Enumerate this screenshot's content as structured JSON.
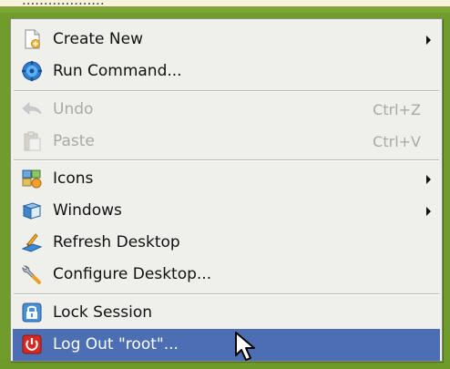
{
  "background": {
    "top_text": "..................."
  },
  "menu": {
    "items": [
      {
        "label": "Create New",
        "icon": "new-document-icon",
        "submenu": true
      },
      {
        "label": "Run Command...",
        "icon": "run-command-gear-icon"
      },
      {
        "label": "Undo",
        "accel": "U",
        "icon": "undo-arrow-icon",
        "shortcut": "Ctrl+Z",
        "disabled": true
      },
      {
        "label": "Paste",
        "accel": "P",
        "icon": "paste-clipboard-icon",
        "shortcut": "Ctrl+V",
        "disabled": true
      },
      {
        "label": "Icons",
        "icon": "icons-icon",
        "submenu": true
      },
      {
        "label": "Windows",
        "icon": "windows-icon",
        "submenu": true
      },
      {
        "label": "Refresh Desktop",
        "icon": "refresh-desktop-icon"
      },
      {
        "label": "Configure Desktop...",
        "icon": "configure-wrench-icon"
      },
      {
        "label": "Lock Session",
        "icon": "lock-icon"
      },
      {
        "label": "Log Out \"root\"...",
        "icon": "logout-power-icon",
        "selected": true
      }
    ]
  },
  "colors": {
    "desktop_green": "#6f9c2a",
    "menu_bg": "#efefec",
    "selection_blue": "#4c6fb4",
    "disabled_text": "#a8a8a4"
  }
}
